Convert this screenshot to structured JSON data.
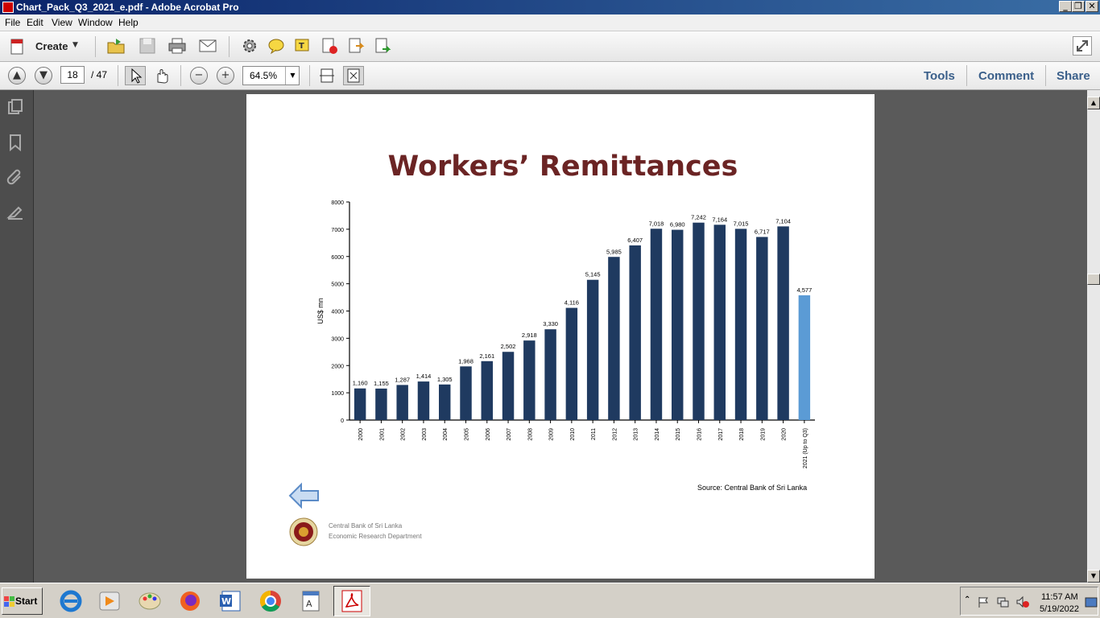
{
  "window": {
    "title": "Chart_Pack_Q3_2021_e.pdf - Adobe Acrobat Pro",
    "minimize": "_",
    "restore": "❐",
    "close": "✕"
  },
  "menu": [
    "File",
    "Edit",
    "View",
    "Window",
    "Help"
  ],
  "toolbar": {
    "create_label": "Create"
  },
  "nav": {
    "page_current": "18",
    "page_total": "/ 47",
    "zoom": "64.5%"
  },
  "panes": {
    "tools": "Tools",
    "comment": "Comment",
    "share": "Share"
  },
  "document": {
    "title": "Workers’ Remittances",
    "source": "Source: Central Bank of Sri Lanka",
    "org_line1": "Central Bank of Sri Lanka",
    "org_line2": "Economic Research Department"
  },
  "chart_data": {
    "type": "bar",
    "title": "Workers’ Remittances",
    "ylabel": "US$ mn",
    "xlabel": "",
    "ylim": [
      0,
      8000
    ],
    "yticks": [
      "0",
      "1000",
      "2000",
      "3000",
      "4000",
      "5000",
      "6000",
      "7000",
      "8000"
    ],
    "categories": [
      "2000",
      "2001",
      "2002",
      "2003",
      "2004",
      "2005",
      "2006",
      "2007",
      "2008",
      "2009",
      "2010",
      "2011",
      "2012",
      "2013",
      "2014",
      "2015",
      "2016",
      "2017",
      "2018",
      "2019",
      "2020",
      "2021 (Up to Q3)"
    ],
    "values": [
      1160,
      1155,
      1287,
      1414,
      1305,
      1968,
      2161,
      2502,
      2918,
      3330,
      4116,
      5145,
      5985,
      6407,
      7018,
      6980,
      7242,
      7164,
      7015,
      6717,
      7104,
      4577
    ],
    "value_labels": [
      "1,160",
      "1,155",
      "1,287",
      "1,414",
      "1,305",
      "1,968",
      "2,161",
      "2,502",
      "2,918",
      "3,330",
      "4,116",
      "5,145",
      "5,985",
      "6,407",
      "7,018",
      "6,980",
      "7,242",
      "7,164",
      "7,015",
      "6,717",
      "7,104",
      "4,577"
    ],
    "bar_color": "#1f3a60",
    "highlight_color": "#5b9bd5",
    "grid": false
  },
  "taskbar": {
    "start_label": "Start",
    "time": "11:57 AM",
    "date": "5/19/2022"
  }
}
